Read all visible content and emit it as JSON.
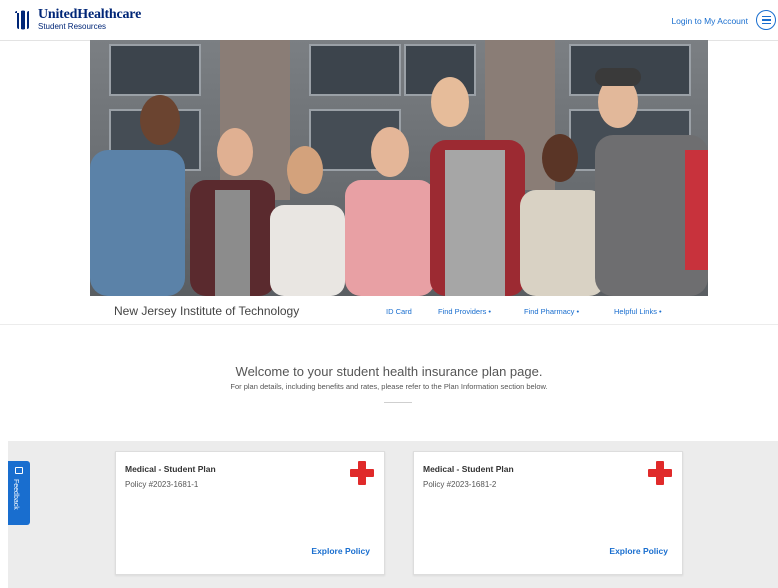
{
  "header": {
    "brand_name": "UnitedHealthcare",
    "brand_sub": "Student Resources",
    "login_label": "Login to My Account",
    "menu_icon": "hamburger-icon"
  },
  "hero": {
    "alt": "group-of-students-photo"
  },
  "nav": {
    "school": "New Jersey Institute of Technology",
    "links": [
      {
        "label": "ID Card"
      },
      {
        "label": "Find Providers •"
      },
      {
        "label": "Find Pharmacy •"
      },
      {
        "label": "Helpful Links •"
      }
    ]
  },
  "welcome": {
    "title": "Welcome to your student health insurance plan page.",
    "subtitle": "For plan details, including benefits and rates, please refer to the Plan Information section below."
  },
  "cards": [
    {
      "title": "Medical - Student Plan",
      "policy": "Policy #2023-1681-1",
      "cta": "Explore Policy"
    },
    {
      "title": "Medical - Student Plan",
      "policy": "Policy #2023-1681-2",
      "cta": "Explore Policy"
    }
  ],
  "feedback": {
    "label": "Feedback"
  },
  "colors": {
    "brand_navy": "#002677",
    "link_blue": "#196ecf",
    "cross_red": "#e02a2a",
    "band_gray": "#ececec"
  }
}
